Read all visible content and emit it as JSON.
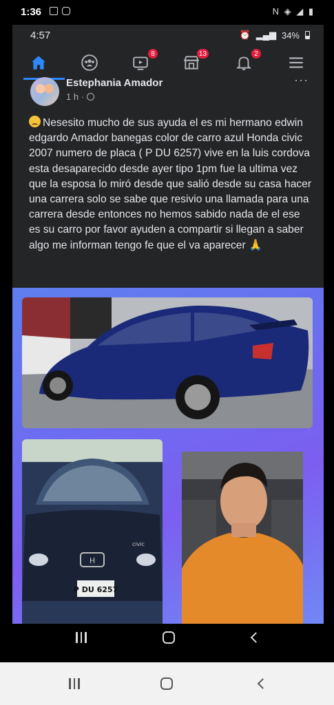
{
  "outer_status": {
    "time": "1:36",
    "right_icons": "N ◈ ◢ ▮"
  },
  "inner_status": {
    "time": "4:57",
    "battery": "34%"
  },
  "nav": {
    "tabs": [
      {
        "icon": "home-icon",
        "badge": null
      },
      {
        "icon": "groups-icon",
        "badge": null
      },
      {
        "icon": "watch-icon",
        "badge": "8"
      },
      {
        "icon": "marketplace-icon",
        "badge": "13"
      },
      {
        "icon": "bell-icon",
        "badge": "2"
      },
      {
        "icon": "menu-icon",
        "badge": null
      }
    ]
  },
  "post": {
    "author": "Estephania Amador",
    "time": "1 h ·",
    "text": "Nesesito mucho de sus ayuda el es mi hermano edwin edgardo Amador banegas  color de carro azul Honda civic 2007 numero de placa ( P DU 6257) vive en la luis cordova  esta desaparecido desde ayer tipo 1pm fue la ultima vez que la esposa lo miró desde que salió desde su casa hacer una carrera solo se sabe que resivio una llamada para una carrera desde entonces no hemos sabido nada de el  ese es su carro por favor ayuden a compartir si llegan a saber algo me informan tengo fe que el va aparecer"
  },
  "photos": {
    "plate": "P DU 6257",
    "model_badge": "civic"
  },
  "colors": {
    "accent": "#2d88ff",
    "badge": "#e41e3f",
    "photo_bg": "#6a6ff0"
  }
}
